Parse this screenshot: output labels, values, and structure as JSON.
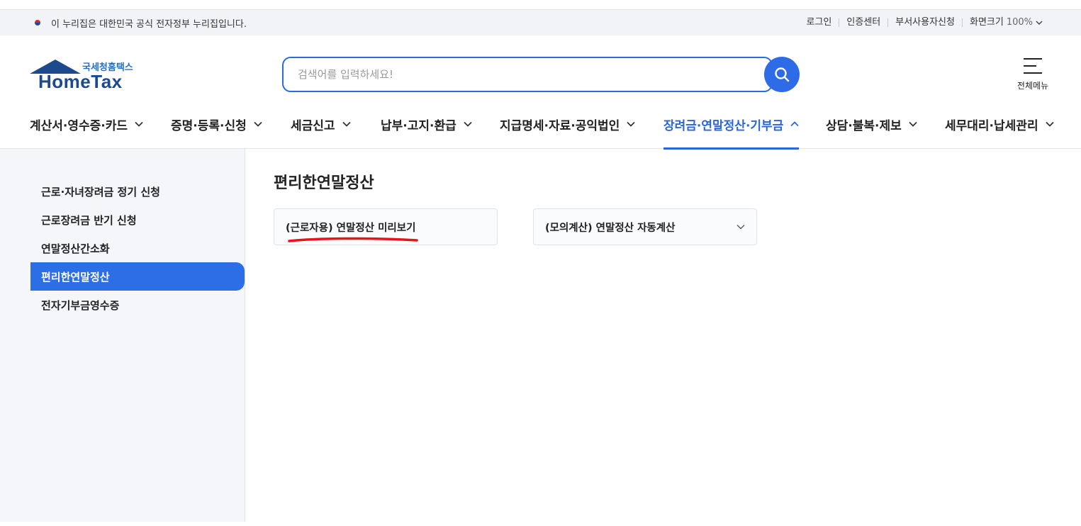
{
  "gov_bar": {
    "notice": "이 누리집은 대한민국 공식 전자정부 누리집입니다.",
    "links": [
      "로그인",
      "인증센터",
      "부서사용자신청"
    ],
    "zoom_label": "화면크기",
    "zoom_value": "100%"
  },
  "logo": {
    "small_text": "국세청홈택스",
    "big_text": "HomeTax"
  },
  "search": {
    "placeholder": "검색어를 입력하세요!"
  },
  "all_menu": {
    "label": "전체메뉴"
  },
  "gnb": {
    "items": [
      {
        "label": "계산서·영수증·카드",
        "active": false
      },
      {
        "label": "증명·등록·신청",
        "active": false
      },
      {
        "label": "세금신고",
        "active": false
      },
      {
        "label": "납부·고지·환급",
        "active": false
      },
      {
        "label": "지급명세·자료·공익법인",
        "active": false
      },
      {
        "label": "장려금·연말정산·기부금",
        "active": true
      },
      {
        "label": "상담·불복·제보",
        "active": false
      },
      {
        "label": "세무대리·납세관리",
        "active": false
      }
    ]
  },
  "sidebar": {
    "items": [
      {
        "label": "근로·자녀장려금 정기 신청",
        "active": false
      },
      {
        "label": "근로장려금 반기 신청",
        "active": false
      },
      {
        "label": "연말정산간소화",
        "active": false
      },
      {
        "label": "편리한연말정산",
        "active": true
      },
      {
        "label": "전자기부금영수증",
        "active": false
      }
    ]
  },
  "main": {
    "title": "편리한연말정산",
    "cards": [
      {
        "label": "(근로자용) 연말정산 미리보기"
      },
      {
        "label": "(모의계산) 연말정산 자동계산"
      }
    ]
  },
  "colors": {
    "accent": "#2c6ee6",
    "logo": "#1c4a8d",
    "annotation": "#e8141b"
  }
}
